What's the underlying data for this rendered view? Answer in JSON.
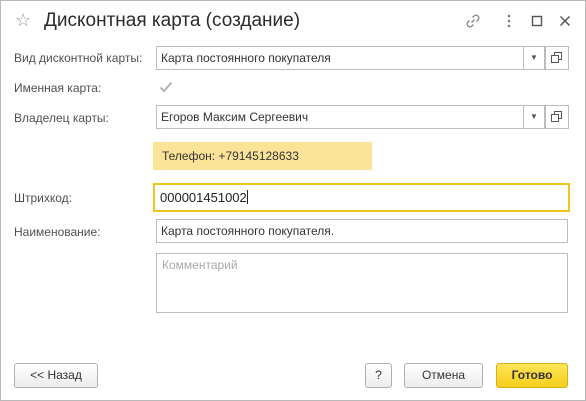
{
  "window": {
    "title": "Дисконтная карта (создание)",
    "icons": [
      "star-icon",
      "link-icon",
      "more-icon",
      "maximize-icon",
      "close-icon"
    ]
  },
  "form": {
    "card_type_label": "Вид дисконтной карты:",
    "card_type_value": "Карта постоянного покупателя",
    "named_card_label": "Именная карта:",
    "named_card_checked": true,
    "owner_label": "Владелец карты:",
    "owner_value": "Егоров Максим Сергеевич",
    "phone_info": "Телефон: +79145128633",
    "barcode_label": "Штрихкод:",
    "barcode_value": "000001451002",
    "name_label": "Наименование:",
    "name_value": "Карта постоянного покупателя.",
    "comment_placeholder": "Комментарий"
  },
  "buttons": {
    "back": "<< Назад",
    "help": "?",
    "cancel": "Отмена",
    "done": "Готово"
  },
  "colors": {
    "accent": "#f5cf1a",
    "highlight": "#fbe497"
  }
}
